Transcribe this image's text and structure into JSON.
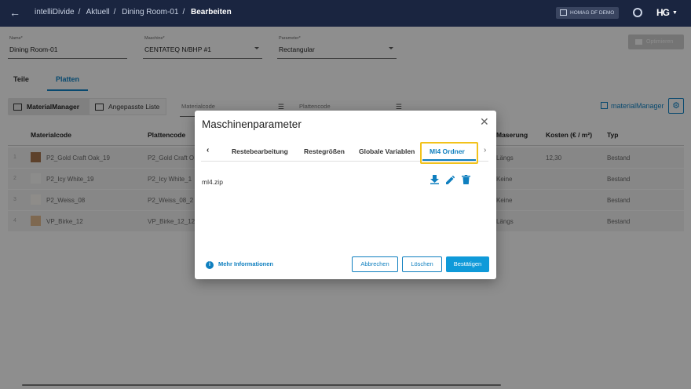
{
  "topbar": {
    "app": "intelliDivide",
    "crumb1": "Aktuell",
    "crumb2": "Dining Room-01",
    "current": "Bearbeiten",
    "demo_label": "HOMAG DF DEMO",
    "logo": "HG"
  },
  "form": {
    "name_label": "Name*",
    "name_value": "Dining Room-01",
    "machine_label": "Maschine*",
    "machine_value": "CENTATEQ N/BHP #1",
    "param_label": "Parameter*",
    "param_value": "Rectangular",
    "optimize_label": "Optimieren"
  },
  "tabs": {
    "teile": "Teile",
    "platten": "Platten"
  },
  "toolbar": {
    "material_manager": "MaterialManager",
    "custom_list": "Angepasste Liste",
    "materialcode_ph": "Materialcode",
    "plattencode_ph": "Plattencode",
    "mm_link": "materialManager"
  },
  "table": {
    "headers": {
      "materialcode": "Materialcode",
      "plattencode": "Plattencode",
      "maserung": "Maserung",
      "kosten": "Kosten (€ / m²)",
      "typ": "Typ"
    },
    "rows": [
      {
        "idx": "1",
        "material": "P2_Gold Craft Oak_19",
        "platte": "P2_Gold Craft O",
        "maserung": "Längs",
        "kosten": "12,30",
        "typ": "Bestand",
        "swatch": "#a0704a"
      },
      {
        "idx": "2",
        "material": "P2_Icy White_19",
        "platte": "P2_Icy White_1",
        "maserung": "Keine",
        "kosten": "",
        "typ": "Bestand",
        "swatch": "#f2f2f0"
      },
      {
        "idx": "3",
        "material": "P2_Weiss_08",
        "platte": "P2_Weiss_08_2",
        "maserung": "Keine",
        "kosten": "",
        "typ": "Bestand",
        "swatch": "#f4f2ec"
      },
      {
        "idx": "4",
        "material": "VP_Birke_12",
        "platte": "VP_Birke_12_12",
        "maserung": "Längs",
        "kosten": "",
        "typ": "Bestand",
        "swatch": "#d9b48a"
      }
    ]
  },
  "modal": {
    "title": "Maschinenparameter",
    "tabs": [
      "Restebearbeitung",
      "Restegrößen",
      "Globale Variablen",
      "Ml4 Ordner"
    ],
    "active_tab": "Ml4 Ordner",
    "file": "ml4.zip",
    "more_info": "Mehr Informationen",
    "cancel": "Abbrechen",
    "delete": "Löschen",
    "confirm": "Bestätigen"
  },
  "colors": {
    "accent": "#0f7fbf",
    "highlight": "#f2c21b",
    "topbar": "#1a2540"
  }
}
